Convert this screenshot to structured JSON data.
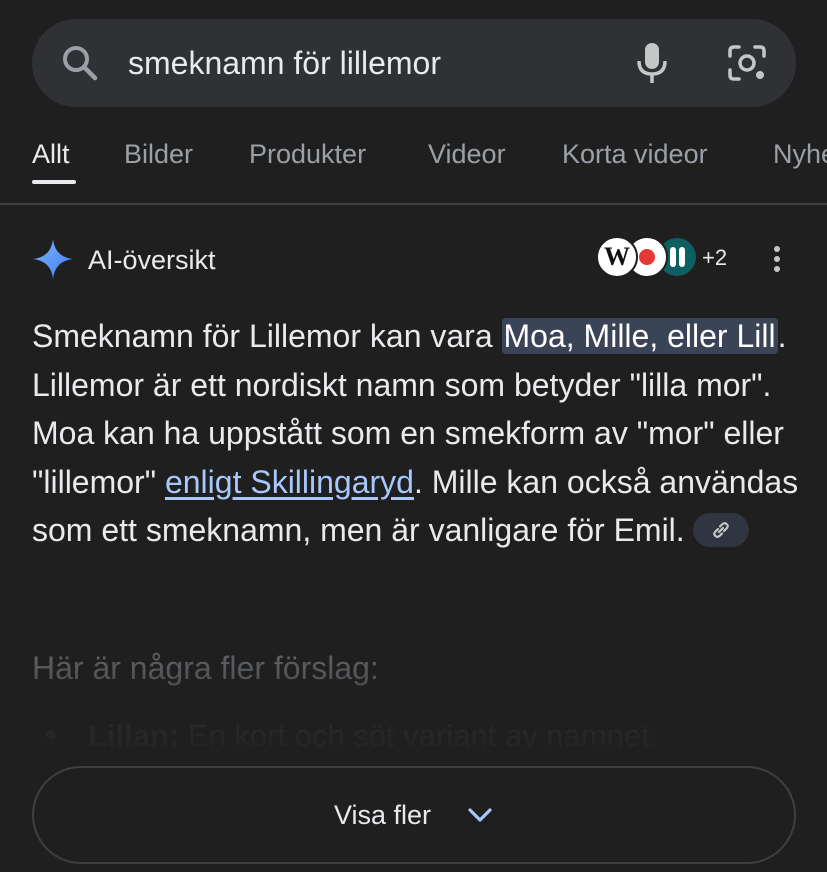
{
  "search": {
    "query": "smeknamn för lillemor"
  },
  "tabs": [
    {
      "label": "Allt",
      "active": true
    },
    {
      "label": "Bilder"
    },
    {
      "label": "Produkter"
    },
    {
      "label": "Videor"
    },
    {
      "label": "Korta videor"
    },
    {
      "label": "Nyheter"
    }
  ],
  "ai_overview": {
    "title": "AI-översikt",
    "sources": {
      "icons": [
        "wikipedia-logo",
        "red-dot-logo",
        "teal-pause-logo"
      ],
      "wiki_glyph": "W",
      "more_count": "+2"
    },
    "answer": {
      "part1": "Smeknamn för Lillemor kan vara ",
      "highlight": "Moa, Mille, eller Lill",
      "part2": ". Lillemor är ett nordiskt namn som betyder \"lilla mor\". Moa kan ha uppstått som en smekform av \"mor\" eller \"lillemor\" ",
      "link": "enligt Skillingaryd",
      "part3": ". Mille kan också användas som ett smeknamn, men är vanligare för Emil."
    },
    "more_heading": "Här är några fler förslag:",
    "suggestions": [
      {
        "name": "Lillan:",
        "text": " En kort och söt variant av namnet."
      }
    ],
    "show_more_label": "Visa fler"
  },
  "colors": {
    "background": "#1f1f1f",
    "search_bg": "#303134",
    "highlight": "#394457",
    "link": "#a8c7fa",
    "sparkle": "#4e8ef7"
  }
}
